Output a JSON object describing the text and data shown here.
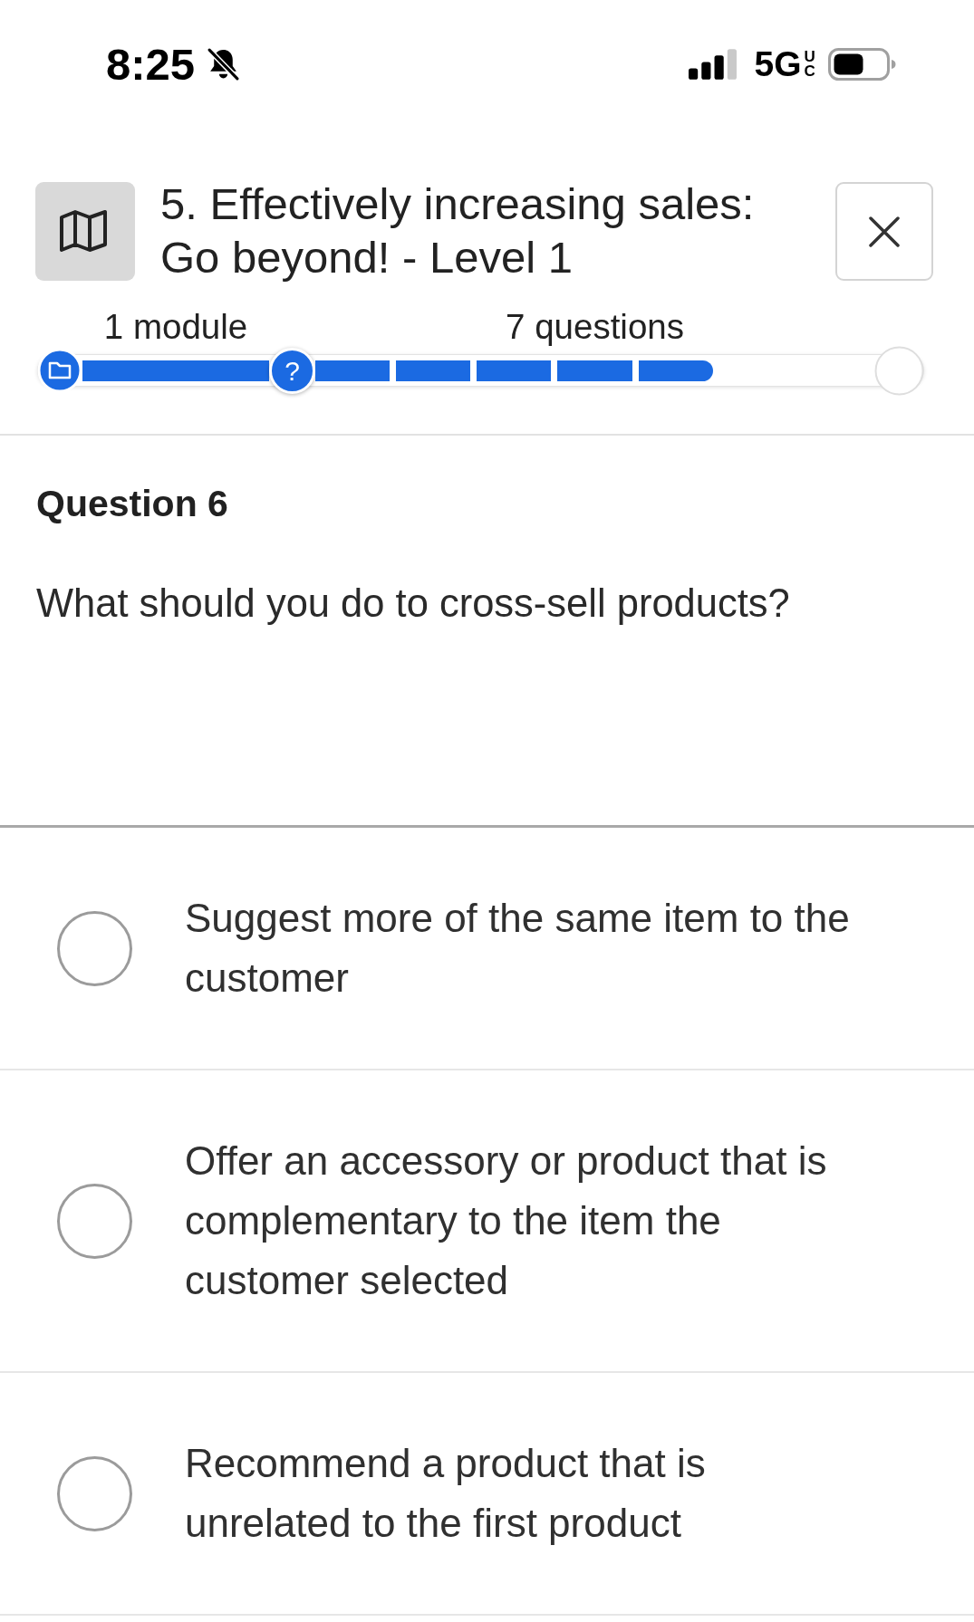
{
  "status_bar": {
    "time": "8:25",
    "network": "5G",
    "network_badge": "UC"
  },
  "header": {
    "title": "5. Effectively increasing sales: Go beyond! - Level 1"
  },
  "progress": {
    "modules_label": "1 module",
    "questions_label": "7 questions",
    "module_completed": true,
    "current_marker": "?",
    "questions": [
      {
        "completed": true
      },
      {
        "completed": true
      },
      {
        "completed": true
      },
      {
        "completed": true
      },
      {
        "completed": true
      },
      {
        "completed": false
      },
      {
        "completed": false
      }
    ]
  },
  "question": {
    "heading": "Question 6",
    "text": "What should you do to cross-sell products?"
  },
  "options": [
    {
      "text": "Suggest more of the same item to the customer",
      "selected": false
    },
    {
      "text": "Offer an accessory or product that is complementary to the item the customer selected",
      "selected": false
    },
    {
      "text": "Recommend a product that is unrelated to the first product",
      "selected": false
    }
  ]
}
